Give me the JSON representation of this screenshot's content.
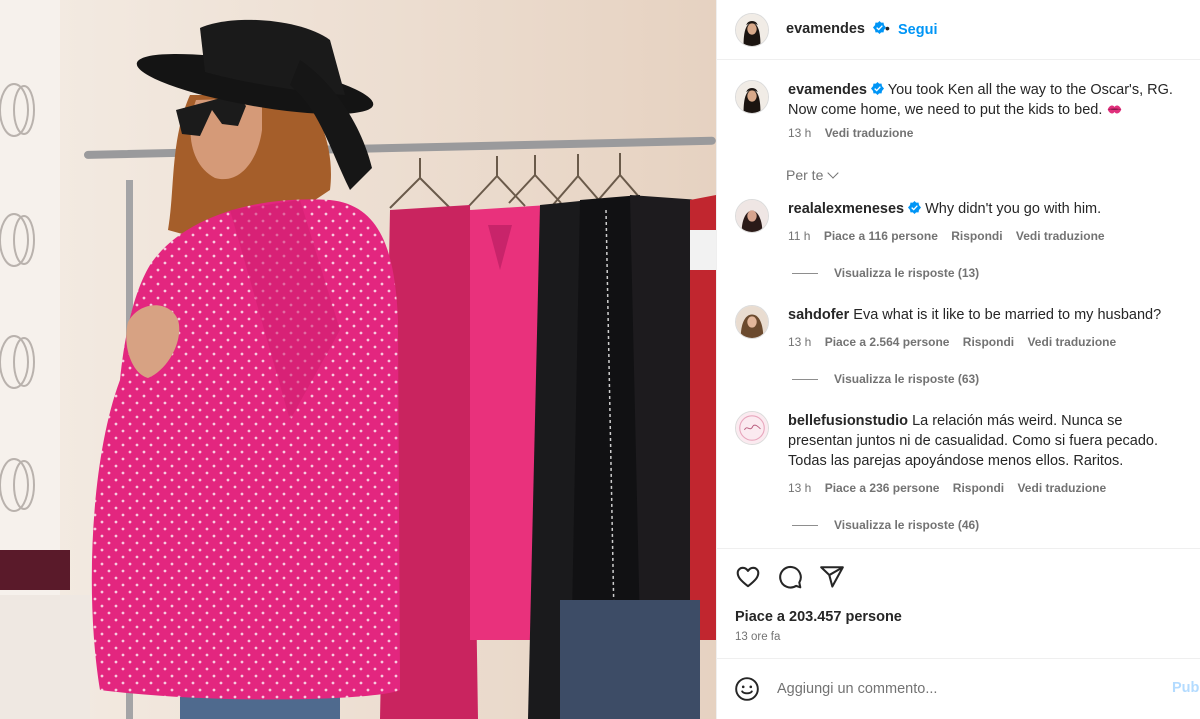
{
  "post": {
    "username": "evamendes",
    "follow_label": "Segui",
    "dot": "•",
    "caption": {
      "username": "evamendes",
      "text": "You took Ken all the way to the Oscar's, RG. Now come home, we need to put the kids to bed.",
      "time": "13 h",
      "translate": "Vedi traduzione"
    },
    "filter_label": "Per te",
    "likes": "Piace a 203.457 persone",
    "time_ago": "13 ore fa"
  },
  "comments": [
    {
      "username": "realalexmeneses",
      "verified": true,
      "text": "Why didn't you go with him.",
      "time": "11 h",
      "likes": "Piace a 116 persone",
      "reply": "Rispondi",
      "translate": "Vedi traduzione",
      "replies": "Visualizza le risposte (13)"
    },
    {
      "username": "sahdofer",
      "verified": false,
      "text": "Eva what is it like to be married to my husband?",
      "time": "13 h",
      "likes": "Piace a 2.564 persone",
      "reply": "Rispondi",
      "translate": "Vedi traduzione",
      "replies": "Visualizza le risposte (63)"
    },
    {
      "username": "bellefusionstudio",
      "verified": false,
      "text": "La relación más weird. Nunca se presentan juntos ni de casualidad. Como si fuera pecado. Todas las parejas apoyándose menos ellos. Raritos.",
      "time": "13 h",
      "likes": "Piace a 236 persone",
      "reply": "Rispondi",
      "translate": "Vedi traduzione",
      "replies": "Visualizza le risposte (46)"
    }
  ],
  "composer": {
    "placeholder": "Aggiungi un commento...",
    "publish_label": "Pubblica"
  },
  "icons": [
    "verified-badge-icon",
    "chevron-down-icon",
    "kiss-emoji-icon",
    "heart-icon",
    "comment-icon",
    "share-icon",
    "emoji-icon"
  ],
  "colors": {
    "accent": "#0095f6",
    "publish_disabled": "#b3dbff",
    "text": "#262626",
    "secondary": "#737373",
    "jacket": "#e0207a"
  }
}
